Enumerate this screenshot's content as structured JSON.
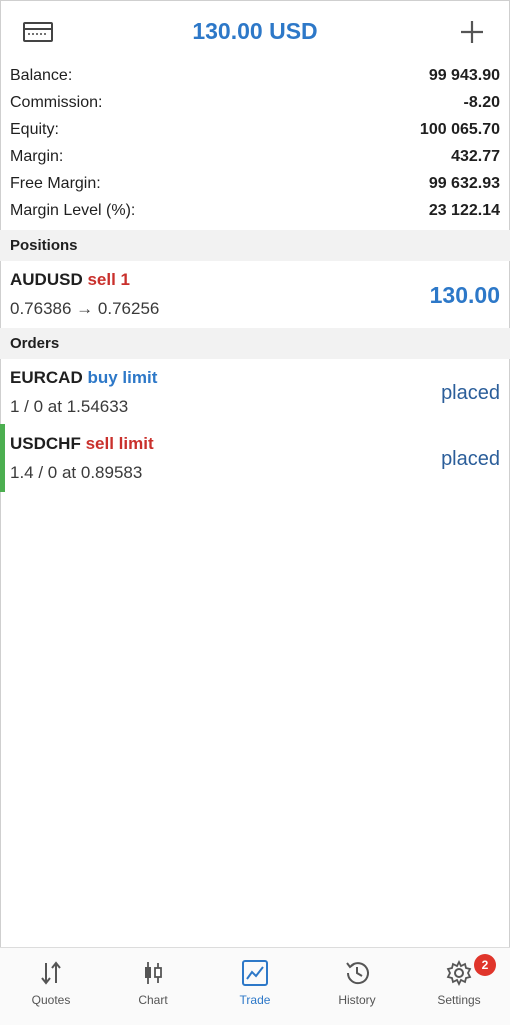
{
  "header": {
    "title": "130.00 USD",
    "left_icon": "trading-account-icon",
    "right_icon": "plus-icon"
  },
  "summary": {
    "rows": [
      {
        "label": "Balance:",
        "value": "99 943.90"
      },
      {
        "label": "Commission:",
        "value": "-8.20"
      },
      {
        "label": "Equity:",
        "value": "100 065.70"
      },
      {
        "label": "Margin:",
        "value": "432.77"
      },
      {
        "label": "Free Margin:",
        "value": "99 632.93"
      },
      {
        "label": "Margin Level (%):",
        "value": "23 122.14"
      }
    ]
  },
  "positions": {
    "header": "Positions",
    "items": [
      {
        "symbol": "AUDUSD",
        "side": "sell 1",
        "prices": "0.76386 → 0.76256",
        "profit": "130.00"
      }
    ]
  },
  "orders": {
    "header": "Orders",
    "items": [
      {
        "symbol": "EURCAD",
        "side": "buy limit",
        "detail": "1 / 0 at 1.54633",
        "status": "placed"
      },
      {
        "symbol": "USDCHF",
        "side": "sell limit",
        "detail": "1.4 / 0 at 0.89583",
        "status": "placed"
      }
    ]
  },
  "tabs": [
    {
      "label": "Quotes",
      "icon": "quotes-arrows-icon"
    },
    {
      "label": "Chart",
      "icon": "candlestick-chart-icon"
    },
    {
      "label": "Trade",
      "icon": "trade-chart-icon"
    },
    {
      "label": "History",
      "icon": "history-clock-icon"
    },
    {
      "label": "Settings",
      "icon": "settings-gear-icon",
      "badge": "2"
    }
  ],
  "active_tab": "Trade",
  "colors": {
    "accent_blue": "#2d78c8",
    "sell_red": "#c9302c",
    "order_green_bar": "#4caf50",
    "badge_red": "#e0352b"
  }
}
